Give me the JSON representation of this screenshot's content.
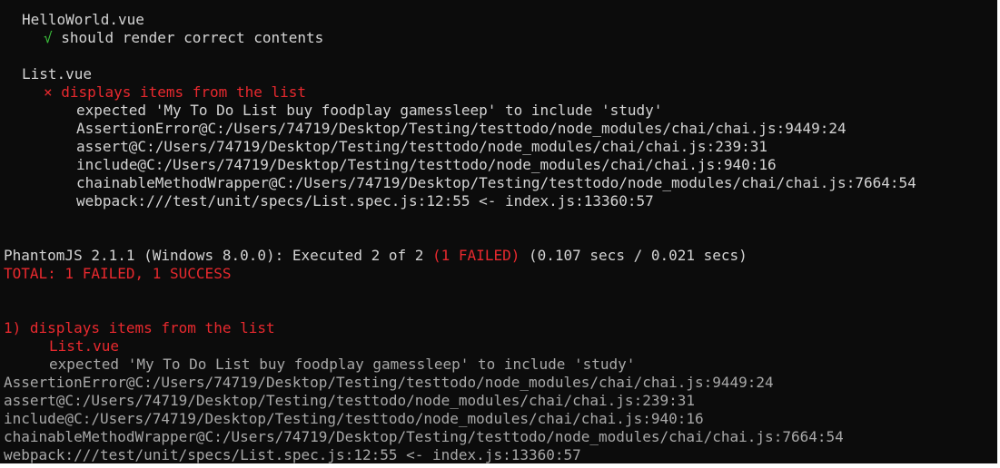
{
  "spec1": {
    "file": "HelloWorld.vue",
    "pass_mark": "√",
    "test": "should render correct contents"
  },
  "spec2": {
    "file": "List.vue",
    "fail_mark": "×",
    "test": "displays items from the list",
    "stack": [
      "expected 'My To Do List buy foodplay gamessleep' to include 'study'",
      "AssertionError@C:/Users/74719/Desktop/Testing/testtodo/node_modules/chai/chai.js:9449:24",
      "assert@C:/Users/74719/Desktop/Testing/testtodo/node_modules/chai/chai.js:239:31",
      "include@C:/Users/74719/Desktop/Testing/testtodo/node_modules/chai/chai.js:940:16",
      "chainableMethodWrapper@C:/Users/74719/Desktop/Testing/testtodo/node_modules/chai/chai.js:7664:54",
      "webpack:///test/unit/specs/List.spec.js:12:55 <- index.js:13360:57"
    ]
  },
  "summary": {
    "runner": "PhantomJS 2.1.1 (Windows 8.0.0): Executed 2 of 2",
    "failed": "(1 FAILED)",
    "timing": "(0.107 secs / 0.021 secs)",
    "total": "TOTAL: 1 FAILED, 1 SUCCESS"
  },
  "failure_detail": {
    "title": "1) displays items from the list",
    "file": "List.vue",
    "message": "expected 'My To Do List buy foodplay gamessleep' to include 'study'",
    "stack": [
      "AssertionError@C:/Users/74719/Desktop/Testing/testtodo/node_modules/chai/chai.js:9449:24",
      "assert@C:/Users/74719/Desktop/Testing/testtodo/node_modules/chai/chai.js:239:31",
      "include@C:/Users/74719/Desktop/Testing/testtodo/node_modules/chai/chai.js:940:16",
      "chainableMethodWrapper@C:/Users/74719/Desktop/Testing/testtodo/node_modules/chai/chai.js:7664:54",
      "webpack:///test/unit/specs/List.spec.js:12:55 <- index.js:13360:57"
    ]
  },
  "colors": {
    "background": "#0c0c0c",
    "text": "#cccccc",
    "error": "#e8292e",
    "success": "#3bbf3b",
    "dim": "#a8a8a8"
  }
}
